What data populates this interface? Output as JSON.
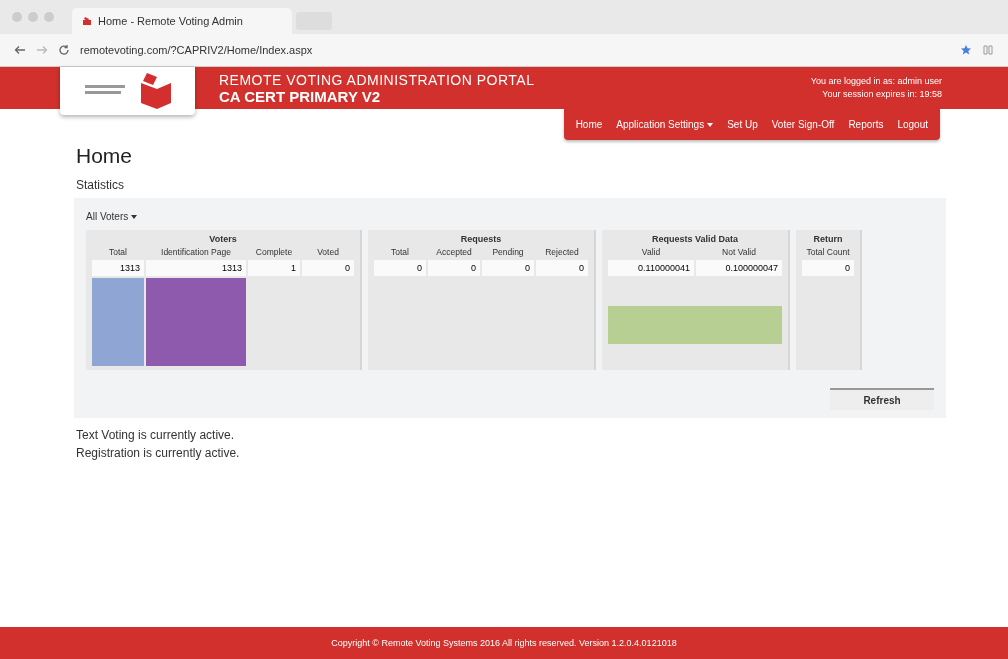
{
  "browser": {
    "tab_title": "Home - Remote Voting Admin",
    "url": "remotevoting.com/?CAPRIV2/Home/Index.aspx"
  },
  "header": {
    "title": "REMOTE VOTING ADMINISTRATION PORTAL",
    "subtitle": "CA CERT PRIMARY V2",
    "user_line": "You are logged in as: admin user",
    "session_line": "Your session expires in: 19:58"
  },
  "nav": [
    {
      "label": "Home",
      "dropdown": false
    },
    {
      "label": "Application Settings",
      "dropdown": true
    },
    {
      "label": "Set Up",
      "dropdown": false
    },
    {
      "label": "Voter Sign-Off",
      "dropdown": false
    },
    {
      "label": "Reports",
      "dropdown": false
    },
    {
      "label": "Logout",
      "dropdown": false
    }
  ],
  "page_title": "Home",
  "section_title": "Statistics",
  "filter": "All Voters",
  "groups": [
    {
      "title": "Voters",
      "columns": [
        {
          "label": "Total",
          "value": "1313",
          "color": "#8fa5d4"
        },
        {
          "label": "Identification Page",
          "value": "1313",
          "color": "#8d5aad"
        },
        {
          "label": "Complete",
          "value": "1"
        },
        {
          "label": "Voted",
          "value": "0"
        }
      ]
    },
    {
      "title": "Requests",
      "columns": [
        {
          "label": "Total",
          "value": "0"
        },
        {
          "label": "Accepted",
          "value": "0"
        },
        {
          "label": "Pending",
          "value": "0"
        },
        {
          "label": "Rejected",
          "value": "0"
        }
      ]
    },
    {
      "title": "Requests Valid Data",
      "color": "#b7cf93",
      "columns": [
        {
          "label": "Valid",
          "value": "0.110000041"
        },
        {
          "label": "Not Valid",
          "value": "0.100000047"
        }
      ]
    },
    {
      "title": "Return",
      "columns": [
        {
          "label": "Total Count",
          "value": "0"
        }
      ]
    }
  ],
  "refresh_button": "Refresh",
  "status_lines": [
    "Text Voting is currently active.",
    "Registration is currently active."
  ],
  "footer": "Copyright © Remote Voting Systems 2016 All rights reserved. Version 1.2.0.4.0121018"
}
